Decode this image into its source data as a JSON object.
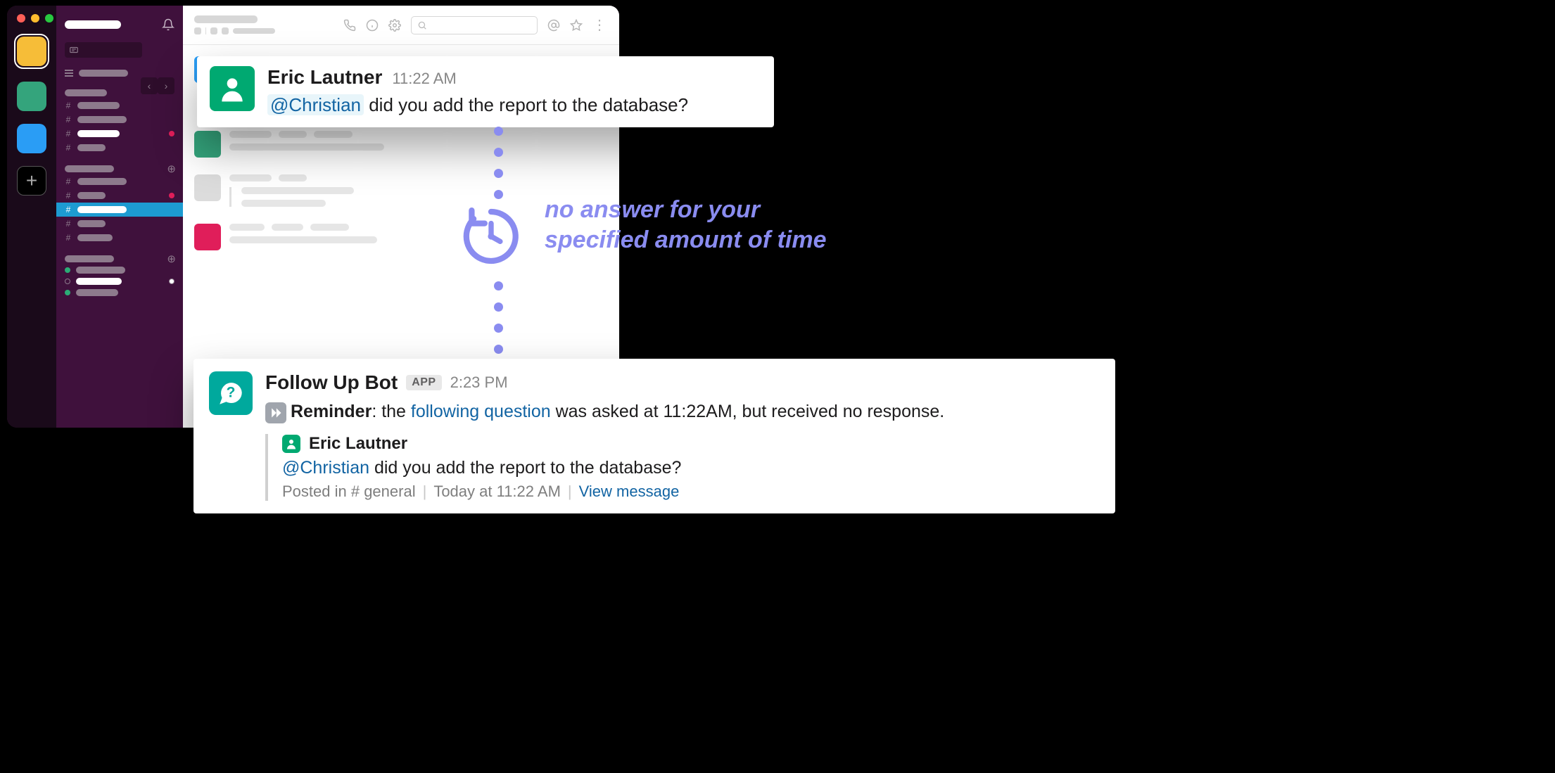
{
  "message1": {
    "author": "Eric Lautner",
    "time": "11:22 AM",
    "mention": "@Christian",
    "text_rest": " did you add the report to the database?"
  },
  "decor": {
    "text": "no answer for your\nspecified amount of time"
  },
  "message2": {
    "botName": "Follow Up Bot",
    "appBadge": "APP",
    "time": "2:23 PM",
    "reminder_label": "Reminder",
    "text_after_reminder": ": the ",
    "link_text": "following question",
    "text_tail": " was asked at 11:22AM, but received no response.",
    "quote": {
      "author": "Eric Lautner",
      "mention": "@Christian",
      "text_rest": " did you add the report to the database?",
      "meta_posted": "Posted in ",
      "meta_channel": "# general",
      "meta_when": "Today at 11:22 AM",
      "meta_view": "View message"
    }
  }
}
